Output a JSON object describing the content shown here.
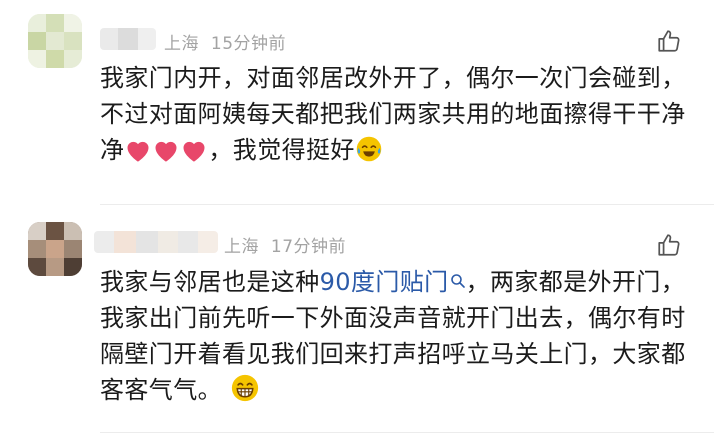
{
  "comments": [
    {
      "location": "上海",
      "time": "15分钟前",
      "text_before": "我家门内开，对面邻居改外开了，偶尔一次门会碰到，不过对面阿姨每天都把我们两家共用的地面擦得干干净净",
      "text_after": "，我觉得挺好",
      "emojis": [
        "heart",
        "heart",
        "heart",
        "crying-laughing"
      ]
    },
    {
      "location": "上海",
      "time": "17分钟前",
      "text_before": "我家与邻居也是这种",
      "link": "90度门贴门",
      "text_after": "，两家都是外开门，我家出门前先听一下外面没声音就开门出去，偶尔有时隔壁门开着看见我们回来打声招呼立马关上门，大家都客客气气。",
      "emojis": [
        "grinning"
      ]
    }
  ],
  "colors": {
    "meta": "#a3a3a3",
    "link": "#2b5aa8",
    "heart": "#e8476a",
    "emoji": "#f5c400"
  }
}
